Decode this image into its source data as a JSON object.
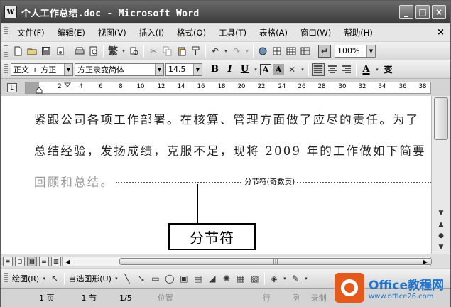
{
  "window": {
    "title": "个人工作总结.doc - Microsoft Word",
    "app_icon_text": "W",
    "controls": {
      "minimize": "_",
      "maximize": "□",
      "close": "×"
    }
  },
  "menubar": {
    "items": [
      {
        "label": "文件(F)"
      },
      {
        "label": "编辑(E)"
      },
      {
        "label": "视图(V)"
      },
      {
        "label": "插入(I)"
      },
      {
        "label": "格式(O)"
      },
      {
        "label": "工具(T)"
      },
      {
        "label": "表格(A)"
      },
      {
        "label": "窗口(W)"
      },
      {
        "label": "帮助(H)"
      }
    ],
    "close_doc": "×"
  },
  "standard_toolbar": {
    "traditional_label": "繁",
    "zoom": "100%"
  },
  "format_toolbar": {
    "style": "正文 + 方正",
    "font": "方正隶变简体",
    "size": "14.5",
    "bold": "B",
    "italic": "I",
    "underline": "U",
    "char_border": "A",
    "char_shading": "A",
    "font_color": "A",
    "phonetic": "变"
  },
  "ruler": {
    "tab_selector": "L",
    "ticks": [
      "2",
      "4",
      "6",
      "8",
      "10",
      "12",
      "14",
      "16",
      "18",
      "20",
      "22",
      "24",
      "26",
      "28",
      "30",
      "32",
      "34",
      "36",
      "38"
    ]
  },
  "document": {
    "line1": "紧跟公司各项工作部署。在核算、管理方面做了应尽的责任。为了",
    "line2": "总结经验，发扬成绩，克服不足，现将 2009 年的工作做如下简要",
    "line3": "回顾和总结。",
    "section_break_label": "分节符(奇数页)",
    "callout": "分节符"
  },
  "drawing_toolbar": {
    "draw_label": "绘图(R)",
    "autoshapes_label": "自选图形(U)"
  },
  "statusbar": {
    "page": "1 页",
    "section": "1 节",
    "page_of": "1/5",
    "position": "位置",
    "line": "行",
    "column": "列",
    "record": "录制"
  },
  "logo": {
    "name": "Office教程网",
    "url": "www.office26.com"
  }
}
